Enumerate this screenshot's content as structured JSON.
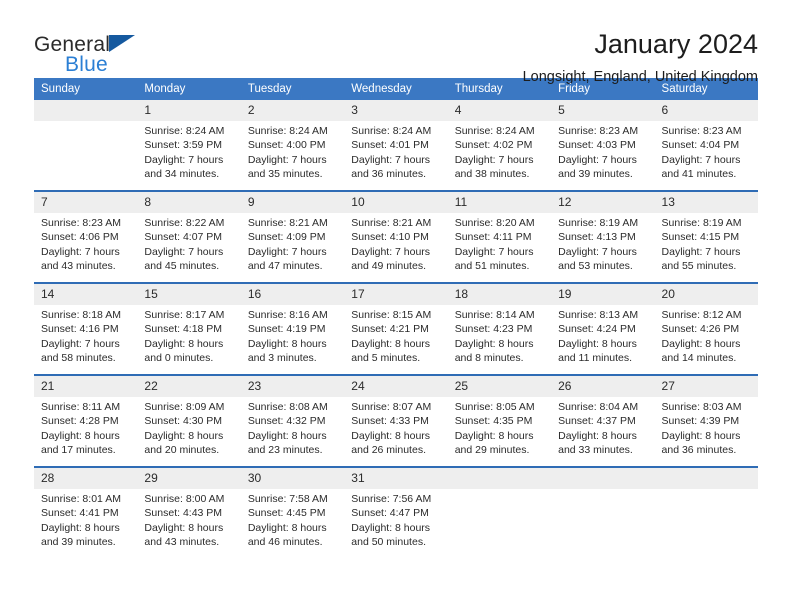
{
  "logo": {
    "word_top": "General",
    "word_bottom": "Blue",
    "accent_color": "#2b7fd4",
    "triangle_color": "#15599f"
  },
  "header": {
    "title": "January 2024",
    "subtitle": "Longsight, England, United Kingdom"
  },
  "theme": {
    "header_blue": "#3b78c3",
    "rule_blue": "#2f6cb5",
    "daynum_band": "#eeeeee",
    "text": "#2b2b2b"
  },
  "calendar": {
    "weekday_headers": [
      "Sunday",
      "Monday",
      "Tuesday",
      "Wednesday",
      "Thursday",
      "Friday",
      "Saturday"
    ],
    "weeks": [
      [
        {
          "day": "",
          "empty": true
        },
        {
          "day": "1",
          "sunrise": "Sunrise: 8:24 AM",
          "sunset": "Sunset: 3:59 PM",
          "daylight1": "Daylight: 7 hours",
          "daylight2": "and 34 minutes."
        },
        {
          "day": "2",
          "sunrise": "Sunrise: 8:24 AM",
          "sunset": "Sunset: 4:00 PM",
          "daylight1": "Daylight: 7 hours",
          "daylight2": "and 35 minutes."
        },
        {
          "day": "3",
          "sunrise": "Sunrise: 8:24 AM",
          "sunset": "Sunset: 4:01 PM",
          "daylight1": "Daylight: 7 hours",
          "daylight2": "and 36 minutes."
        },
        {
          "day": "4",
          "sunrise": "Sunrise: 8:24 AM",
          "sunset": "Sunset: 4:02 PM",
          "daylight1": "Daylight: 7 hours",
          "daylight2": "and 38 minutes."
        },
        {
          "day": "5",
          "sunrise": "Sunrise: 8:23 AM",
          "sunset": "Sunset: 4:03 PM",
          "daylight1": "Daylight: 7 hours",
          "daylight2": "and 39 minutes."
        },
        {
          "day": "6",
          "sunrise": "Sunrise: 8:23 AM",
          "sunset": "Sunset: 4:04 PM",
          "daylight1": "Daylight: 7 hours",
          "daylight2": "and 41 minutes."
        }
      ],
      [
        {
          "day": "7",
          "sunrise": "Sunrise: 8:23 AM",
          "sunset": "Sunset: 4:06 PM",
          "daylight1": "Daylight: 7 hours",
          "daylight2": "and 43 minutes."
        },
        {
          "day": "8",
          "sunrise": "Sunrise: 8:22 AM",
          "sunset": "Sunset: 4:07 PM",
          "daylight1": "Daylight: 7 hours",
          "daylight2": "and 45 minutes."
        },
        {
          "day": "9",
          "sunrise": "Sunrise: 8:21 AM",
          "sunset": "Sunset: 4:09 PM",
          "daylight1": "Daylight: 7 hours",
          "daylight2": "and 47 minutes."
        },
        {
          "day": "10",
          "sunrise": "Sunrise: 8:21 AM",
          "sunset": "Sunset: 4:10 PM",
          "daylight1": "Daylight: 7 hours",
          "daylight2": "and 49 minutes."
        },
        {
          "day": "11",
          "sunrise": "Sunrise: 8:20 AM",
          "sunset": "Sunset: 4:11 PM",
          "daylight1": "Daylight: 7 hours",
          "daylight2": "and 51 minutes."
        },
        {
          "day": "12",
          "sunrise": "Sunrise: 8:19 AM",
          "sunset": "Sunset: 4:13 PM",
          "daylight1": "Daylight: 7 hours",
          "daylight2": "and 53 minutes."
        },
        {
          "day": "13",
          "sunrise": "Sunrise: 8:19 AM",
          "sunset": "Sunset: 4:15 PM",
          "daylight1": "Daylight: 7 hours",
          "daylight2": "and 55 minutes."
        }
      ],
      [
        {
          "day": "14",
          "sunrise": "Sunrise: 8:18 AM",
          "sunset": "Sunset: 4:16 PM",
          "daylight1": "Daylight: 7 hours",
          "daylight2": "and 58 minutes."
        },
        {
          "day": "15",
          "sunrise": "Sunrise: 8:17 AM",
          "sunset": "Sunset: 4:18 PM",
          "daylight1": "Daylight: 8 hours",
          "daylight2": "and 0 minutes."
        },
        {
          "day": "16",
          "sunrise": "Sunrise: 8:16 AM",
          "sunset": "Sunset: 4:19 PM",
          "daylight1": "Daylight: 8 hours",
          "daylight2": "and 3 minutes."
        },
        {
          "day": "17",
          "sunrise": "Sunrise: 8:15 AM",
          "sunset": "Sunset: 4:21 PM",
          "daylight1": "Daylight: 8 hours",
          "daylight2": "and 5 minutes."
        },
        {
          "day": "18",
          "sunrise": "Sunrise: 8:14 AM",
          "sunset": "Sunset: 4:23 PM",
          "daylight1": "Daylight: 8 hours",
          "daylight2": "and 8 minutes."
        },
        {
          "day": "19",
          "sunrise": "Sunrise: 8:13 AM",
          "sunset": "Sunset: 4:24 PM",
          "daylight1": "Daylight: 8 hours",
          "daylight2": "and 11 minutes."
        },
        {
          "day": "20",
          "sunrise": "Sunrise: 8:12 AM",
          "sunset": "Sunset: 4:26 PM",
          "daylight1": "Daylight: 8 hours",
          "daylight2": "and 14 minutes."
        }
      ],
      [
        {
          "day": "21",
          "sunrise": "Sunrise: 8:11 AM",
          "sunset": "Sunset: 4:28 PM",
          "daylight1": "Daylight: 8 hours",
          "daylight2": "and 17 minutes."
        },
        {
          "day": "22",
          "sunrise": "Sunrise: 8:09 AM",
          "sunset": "Sunset: 4:30 PM",
          "daylight1": "Daylight: 8 hours",
          "daylight2": "and 20 minutes."
        },
        {
          "day": "23",
          "sunrise": "Sunrise: 8:08 AM",
          "sunset": "Sunset: 4:32 PM",
          "daylight1": "Daylight: 8 hours",
          "daylight2": "and 23 minutes."
        },
        {
          "day": "24",
          "sunrise": "Sunrise: 8:07 AM",
          "sunset": "Sunset: 4:33 PM",
          "daylight1": "Daylight: 8 hours",
          "daylight2": "and 26 minutes."
        },
        {
          "day": "25",
          "sunrise": "Sunrise: 8:05 AM",
          "sunset": "Sunset: 4:35 PM",
          "daylight1": "Daylight: 8 hours",
          "daylight2": "and 29 minutes."
        },
        {
          "day": "26",
          "sunrise": "Sunrise: 8:04 AM",
          "sunset": "Sunset: 4:37 PM",
          "daylight1": "Daylight: 8 hours",
          "daylight2": "and 33 minutes."
        },
        {
          "day": "27",
          "sunrise": "Sunrise: 8:03 AM",
          "sunset": "Sunset: 4:39 PM",
          "daylight1": "Daylight: 8 hours",
          "daylight2": "and 36 minutes."
        }
      ],
      [
        {
          "day": "28",
          "sunrise": "Sunrise: 8:01 AM",
          "sunset": "Sunset: 4:41 PM",
          "daylight1": "Daylight: 8 hours",
          "daylight2": "and 39 minutes."
        },
        {
          "day": "29",
          "sunrise": "Sunrise: 8:00 AM",
          "sunset": "Sunset: 4:43 PM",
          "daylight1": "Daylight: 8 hours",
          "daylight2": "and 43 minutes."
        },
        {
          "day": "30",
          "sunrise": "Sunrise: 7:58 AM",
          "sunset": "Sunset: 4:45 PM",
          "daylight1": "Daylight: 8 hours",
          "daylight2": "and 46 minutes."
        },
        {
          "day": "31",
          "sunrise": "Sunrise: 7:56 AM",
          "sunset": "Sunset: 4:47 PM",
          "daylight1": "Daylight: 8 hours",
          "daylight2": "and 50 minutes."
        },
        {
          "day": "",
          "empty": true
        },
        {
          "day": "",
          "empty": true
        },
        {
          "day": "",
          "empty": true
        }
      ]
    ]
  }
}
